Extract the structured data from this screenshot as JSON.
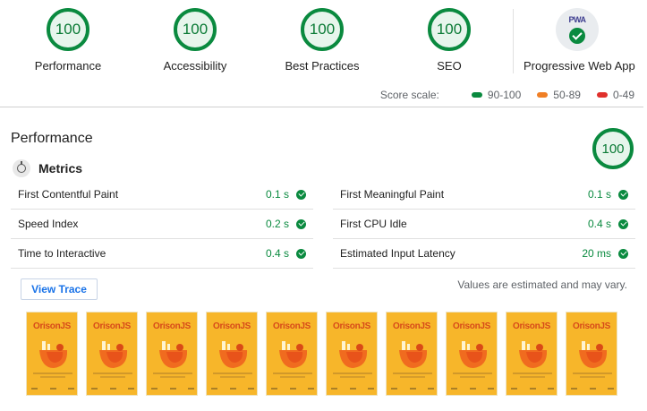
{
  "gauges": [
    {
      "label": "Performance",
      "score": "100"
    },
    {
      "label": "Accessibility",
      "score": "100"
    },
    {
      "label": "Best Practices",
      "score": "100"
    },
    {
      "label": "SEO",
      "score": "100"
    }
  ],
  "pwa": {
    "label": "Progressive Web App",
    "badge_text": "PWA"
  },
  "score_scale": {
    "title": "Score scale:",
    "ranges": [
      {
        "label": "90-100",
        "color": "#0a8a3f"
      },
      {
        "label": "50-89",
        "color": "#f07f25"
      },
      {
        "label": "0-49",
        "color": "#e0302c"
      }
    ]
  },
  "performance": {
    "title": "Performance",
    "score": "100",
    "metrics_title": "Metrics",
    "metrics_left": [
      {
        "name": "First Contentful Paint",
        "value": "0.1 s"
      },
      {
        "name": "Speed Index",
        "value": "0.2 s"
      },
      {
        "name": "Time to Interactive",
        "value": "0.4 s"
      }
    ],
    "metrics_right": [
      {
        "name": "First Meaningful Paint",
        "value": "0.1 s"
      },
      {
        "name": "First CPU Idle",
        "value": "0.4 s"
      },
      {
        "name": "Estimated Input Latency",
        "value": "20 ms"
      }
    ],
    "view_trace_label": "View Trace",
    "estimate_note": "Values are estimated and may vary."
  },
  "filmstrip": {
    "frame_title": "OrisonJS",
    "frame_count": 10
  },
  "colors": {
    "pass": "#0a8a3f",
    "link": "#1a73e8",
    "frame_bg": "#f7b62a"
  }
}
